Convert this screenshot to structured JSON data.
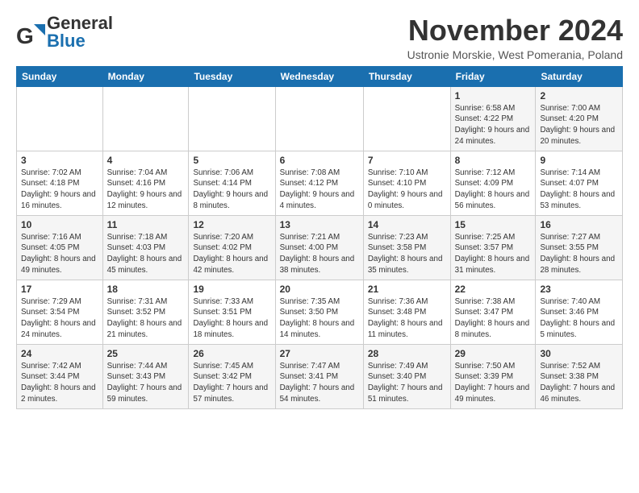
{
  "logo": {
    "general": "General",
    "blue": "Blue"
  },
  "title": "November 2024",
  "subtitle": "Ustronie Morskie, West Pomerania, Poland",
  "weekdays": [
    "Sunday",
    "Monday",
    "Tuesday",
    "Wednesday",
    "Thursday",
    "Friday",
    "Saturday"
  ],
  "weeks": [
    [
      {
        "day": "",
        "info": ""
      },
      {
        "day": "",
        "info": ""
      },
      {
        "day": "",
        "info": ""
      },
      {
        "day": "",
        "info": ""
      },
      {
        "day": "",
        "info": ""
      },
      {
        "day": "1",
        "info": "Sunrise: 6:58 AM\nSunset: 4:22 PM\nDaylight: 9 hours and 24 minutes."
      },
      {
        "day": "2",
        "info": "Sunrise: 7:00 AM\nSunset: 4:20 PM\nDaylight: 9 hours and 20 minutes."
      }
    ],
    [
      {
        "day": "3",
        "info": "Sunrise: 7:02 AM\nSunset: 4:18 PM\nDaylight: 9 hours and 16 minutes."
      },
      {
        "day": "4",
        "info": "Sunrise: 7:04 AM\nSunset: 4:16 PM\nDaylight: 9 hours and 12 minutes."
      },
      {
        "day": "5",
        "info": "Sunrise: 7:06 AM\nSunset: 4:14 PM\nDaylight: 9 hours and 8 minutes."
      },
      {
        "day": "6",
        "info": "Sunrise: 7:08 AM\nSunset: 4:12 PM\nDaylight: 9 hours and 4 minutes."
      },
      {
        "day": "7",
        "info": "Sunrise: 7:10 AM\nSunset: 4:10 PM\nDaylight: 9 hours and 0 minutes."
      },
      {
        "day": "8",
        "info": "Sunrise: 7:12 AM\nSunset: 4:09 PM\nDaylight: 8 hours and 56 minutes."
      },
      {
        "day": "9",
        "info": "Sunrise: 7:14 AM\nSunset: 4:07 PM\nDaylight: 8 hours and 53 minutes."
      }
    ],
    [
      {
        "day": "10",
        "info": "Sunrise: 7:16 AM\nSunset: 4:05 PM\nDaylight: 8 hours and 49 minutes."
      },
      {
        "day": "11",
        "info": "Sunrise: 7:18 AM\nSunset: 4:03 PM\nDaylight: 8 hours and 45 minutes."
      },
      {
        "day": "12",
        "info": "Sunrise: 7:20 AM\nSunset: 4:02 PM\nDaylight: 8 hours and 42 minutes."
      },
      {
        "day": "13",
        "info": "Sunrise: 7:21 AM\nSunset: 4:00 PM\nDaylight: 8 hours and 38 minutes."
      },
      {
        "day": "14",
        "info": "Sunrise: 7:23 AM\nSunset: 3:58 PM\nDaylight: 8 hours and 35 minutes."
      },
      {
        "day": "15",
        "info": "Sunrise: 7:25 AM\nSunset: 3:57 PM\nDaylight: 8 hours and 31 minutes."
      },
      {
        "day": "16",
        "info": "Sunrise: 7:27 AM\nSunset: 3:55 PM\nDaylight: 8 hours and 28 minutes."
      }
    ],
    [
      {
        "day": "17",
        "info": "Sunrise: 7:29 AM\nSunset: 3:54 PM\nDaylight: 8 hours and 24 minutes."
      },
      {
        "day": "18",
        "info": "Sunrise: 7:31 AM\nSunset: 3:52 PM\nDaylight: 8 hours and 21 minutes."
      },
      {
        "day": "19",
        "info": "Sunrise: 7:33 AM\nSunset: 3:51 PM\nDaylight: 8 hours and 18 minutes."
      },
      {
        "day": "20",
        "info": "Sunrise: 7:35 AM\nSunset: 3:50 PM\nDaylight: 8 hours and 14 minutes."
      },
      {
        "day": "21",
        "info": "Sunrise: 7:36 AM\nSunset: 3:48 PM\nDaylight: 8 hours and 11 minutes."
      },
      {
        "day": "22",
        "info": "Sunrise: 7:38 AM\nSunset: 3:47 PM\nDaylight: 8 hours and 8 minutes."
      },
      {
        "day": "23",
        "info": "Sunrise: 7:40 AM\nSunset: 3:46 PM\nDaylight: 8 hours and 5 minutes."
      }
    ],
    [
      {
        "day": "24",
        "info": "Sunrise: 7:42 AM\nSunset: 3:44 PM\nDaylight: 8 hours and 2 minutes."
      },
      {
        "day": "25",
        "info": "Sunrise: 7:44 AM\nSunset: 3:43 PM\nDaylight: 7 hours and 59 minutes."
      },
      {
        "day": "26",
        "info": "Sunrise: 7:45 AM\nSunset: 3:42 PM\nDaylight: 7 hours and 57 minutes."
      },
      {
        "day": "27",
        "info": "Sunrise: 7:47 AM\nSunset: 3:41 PM\nDaylight: 7 hours and 54 minutes."
      },
      {
        "day": "28",
        "info": "Sunrise: 7:49 AM\nSunset: 3:40 PM\nDaylight: 7 hours and 51 minutes."
      },
      {
        "day": "29",
        "info": "Sunrise: 7:50 AM\nSunset: 3:39 PM\nDaylight: 7 hours and 49 minutes."
      },
      {
        "day": "30",
        "info": "Sunrise: 7:52 AM\nSunset: 3:38 PM\nDaylight: 7 hours and 46 minutes."
      }
    ]
  ]
}
